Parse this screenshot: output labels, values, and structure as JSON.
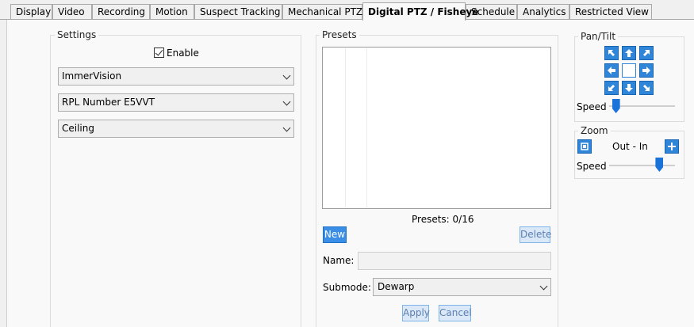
{
  "tabs": [
    {
      "label": "Display",
      "active": false
    },
    {
      "label": "Video",
      "active": false
    },
    {
      "label": "Recording",
      "active": false
    },
    {
      "label": "Motion",
      "active": false
    },
    {
      "label": "Suspect Tracking",
      "active": false
    },
    {
      "label": "Mechanical PTZ",
      "active": false
    },
    {
      "label": "Digital PTZ / Fisheye",
      "active": true
    },
    {
      "label": "Schedule",
      "active": false
    },
    {
      "label": "Analytics",
      "active": false
    },
    {
      "label": "Restricted View",
      "active": false
    }
  ],
  "settings": {
    "title": "Settings",
    "enable_label": "Enable",
    "enable_checked": true,
    "lens_value": "ImmerVision",
    "rpl_value": "RPL Number E5VVT",
    "mount_value": "Ceiling"
  },
  "presets": {
    "title": "Presets",
    "count_text": "Presets:  0/16",
    "new_label": "New",
    "delete_label": "Delete",
    "name_label": "Name:",
    "name_value": "",
    "submode_label": "Submode:",
    "submode_value": "Dewarp",
    "apply_label": "Apply",
    "cancel_label": "Cancel"
  },
  "pantilt": {
    "title": "Pan/Tilt",
    "speed_label": "Speed",
    "speed_level": 0.05
  },
  "zoom": {
    "title": "Zoom",
    "range_label": "Out - In",
    "speed_label": "Speed",
    "speed_level": 0.8
  },
  "colors": {
    "accent": "#2f86d9",
    "slider_thumb": "#1a73d8"
  }
}
